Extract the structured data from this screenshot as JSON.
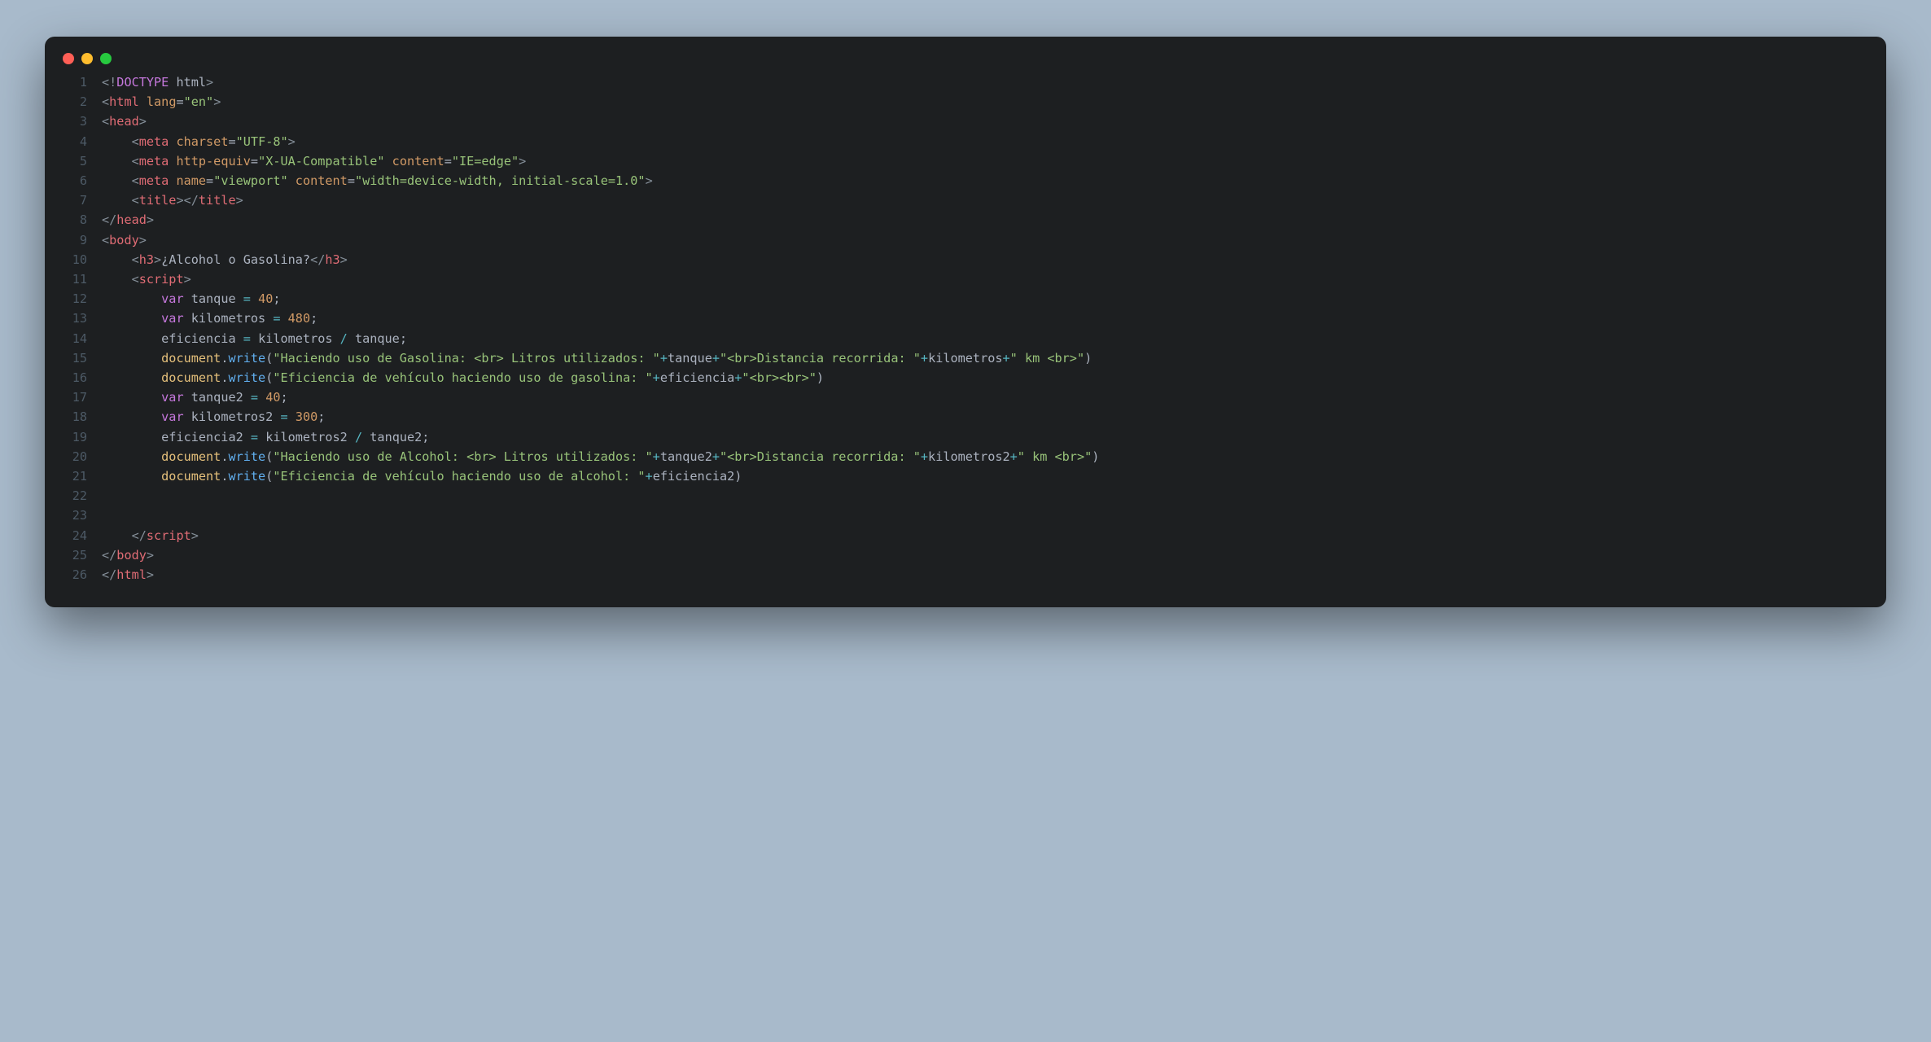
{
  "lines": [
    {
      "n": 1,
      "tokens": [
        [
          "<!",
          "doc"
        ],
        [
          "DOCTYPE",
          "kw"
        ],
        [
          " html",
          "txt"
        ],
        [
          ">",
          "doc"
        ]
      ]
    },
    {
      "n": 2,
      "tokens": [
        [
          "<",
          "p"
        ],
        [
          "html",
          "tag"
        ],
        [
          " ",
          ""
        ],
        [
          "lang",
          "attr"
        ],
        [
          "=",
          "eq"
        ],
        [
          "\"en\"",
          "str"
        ],
        [
          ">",
          "p"
        ]
      ]
    },
    {
      "n": 3,
      "tokens": [
        [
          "<",
          "p"
        ],
        [
          "head",
          "tag"
        ],
        [
          ">",
          "p"
        ]
      ]
    },
    {
      "n": 4,
      "tokens": [
        [
          "    ",
          ""
        ],
        [
          "<",
          "p"
        ],
        [
          "meta",
          "tag"
        ],
        [
          " ",
          ""
        ],
        [
          "charset",
          "attr"
        ],
        [
          "=",
          "eq"
        ],
        [
          "\"UTF-8\"",
          "str"
        ],
        [
          ">",
          "p"
        ]
      ]
    },
    {
      "n": 5,
      "tokens": [
        [
          "    ",
          ""
        ],
        [
          "<",
          "p"
        ],
        [
          "meta",
          "tag"
        ],
        [
          " ",
          ""
        ],
        [
          "http-equiv",
          "attr"
        ],
        [
          "=",
          "eq"
        ],
        [
          "\"X-UA-Compatible\"",
          "str"
        ],
        [
          " ",
          ""
        ],
        [
          "content",
          "attr"
        ],
        [
          "=",
          "eq"
        ],
        [
          "\"IE=edge\"",
          "str"
        ],
        [
          ">",
          "p"
        ]
      ]
    },
    {
      "n": 6,
      "tokens": [
        [
          "    ",
          ""
        ],
        [
          "<",
          "p"
        ],
        [
          "meta",
          "tag"
        ],
        [
          " ",
          ""
        ],
        [
          "name",
          "attr"
        ],
        [
          "=",
          "eq"
        ],
        [
          "\"viewport\"",
          "str"
        ],
        [
          " ",
          ""
        ],
        [
          "content",
          "attr"
        ],
        [
          "=",
          "eq"
        ],
        [
          "\"width=device-width, initial-scale=1.0\"",
          "str"
        ],
        [
          ">",
          "p"
        ]
      ]
    },
    {
      "n": 7,
      "tokens": [
        [
          "    ",
          ""
        ],
        [
          "<",
          "p"
        ],
        [
          "title",
          "tag"
        ],
        [
          ">",
          "p"
        ],
        [
          "</",
          "p"
        ],
        [
          "title",
          "tag"
        ],
        [
          ">",
          "p"
        ]
      ]
    },
    {
      "n": 8,
      "tokens": [
        [
          "</",
          "p"
        ],
        [
          "head",
          "tag"
        ],
        [
          ">",
          "p"
        ]
      ]
    },
    {
      "n": 9,
      "tokens": [
        [
          "<",
          "p"
        ],
        [
          "body",
          "tag"
        ],
        [
          ">",
          "p"
        ]
      ]
    },
    {
      "n": 10,
      "tokens": [
        [
          "    ",
          ""
        ],
        [
          "<",
          "p"
        ],
        [
          "h3",
          "tag"
        ],
        [
          ">",
          "p"
        ],
        [
          "¿Alcohol o Gasolina?",
          "txt"
        ],
        [
          "</",
          "p"
        ],
        [
          "h3",
          "tag"
        ],
        [
          ">",
          "p"
        ]
      ]
    },
    {
      "n": 11,
      "tokens": [
        [
          "    ",
          ""
        ],
        [
          "<",
          "p"
        ],
        [
          "script",
          "tag"
        ],
        [
          ">",
          "p"
        ]
      ]
    },
    {
      "n": 12,
      "tokens": [
        [
          "        ",
          ""
        ],
        [
          "var",
          "jkw"
        ],
        [
          " ",
          ""
        ],
        [
          "tanque",
          "txt"
        ],
        [
          " ",
          ""
        ],
        [
          "=",
          "jop"
        ],
        [
          " ",
          ""
        ],
        [
          "40",
          "jnum"
        ],
        [
          ";",
          "jpun"
        ]
      ]
    },
    {
      "n": 13,
      "tokens": [
        [
          "        ",
          ""
        ],
        [
          "var",
          "jkw"
        ],
        [
          " ",
          ""
        ],
        [
          "kilometros",
          "txt"
        ],
        [
          " ",
          ""
        ],
        [
          "=",
          "jop"
        ],
        [
          " ",
          ""
        ],
        [
          "480",
          "jnum"
        ],
        [
          ";",
          "jpun"
        ]
      ]
    },
    {
      "n": 14,
      "tokens": [
        [
          "        ",
          ""
        ],
        [
          "eficiencia",
          "txt"
        ],
        [
          " ",
          ""
        ],
        [
          "=",
          "jop"
        ],
        [
          " ",
          ""
        ],
        [
          "kilometros",
          "txt"
        ],
        [
          " ",
          ""
        ],
        [
          "/",
          "jop"
        ],
        [
          " ",
          ""
        ],
        [
          "tanque",
          "txt"
        ],
        [
          ";",
          "jpun"
        ]
      ]
    },
    {
      "n": 15,
      "tokens": [
        [
          "        ",
          ""
        ],
        [
          "document",
          "jvar"
        ],
        [
          ".",
          "jpun"
        ],
        [
          "write",
          "jfn"
        ],
        [
          "(",
          "jpun"
        ],
        [
          "\"Haciendo uso de Gasolina: <br> Litros utilizados: \"",
          "str"
        ],
        [
          "+",
          "jop"
        ],
        [
          "tanque",
          "txt"
        ],
        [
          "+",
          "jop"
        ],
        [
          "\"<br>Distancia recorrida: \"",
          "str"
        ],
        [
          "+",
          "jop"
        ],
        [
          "kilometros",
          "txt"
        ],
        [
          "+",
          "jop"
        ],
        [
          "\" km <br>\"",
          "str"
        ],
        [
          ")",
          "jpun"
        ]
      ]
    },
    {
      "n": 16,
      "tokens": [
        [
          "        ",
          ""
        ],
        [
          "document",
          "jvar"
        ],
        [
          ".",
          "jpun"
        ],
        [
          "write",
          "jfn"
        ],
        [
          "(",
          "jpun"
        ],
        [
          "\"Eficiencia de vehículo haciendo uso de gasolina: \"",
          "str"
        ],
        [
          "+",
          "jop"
        ],
        [
          "eficiencia",
          "txt"
        ],
        [
          "+",
          "jop"
        ],
        [
          "\"<br><br>\"",
          "str"
        ],
        [
          ")",
          "jpun"
        ]
      ]
    },
    {
      "n": 17,
      "tokens": [
        [
          "        ",
          ""
        ],
        [
          "var",
          "jkw"
        ],
        [
          " ",
          ""
        ],
        [
          "tanque2",
          "txt"
        ],
        [
          " ",
          ""
        ],
        [
          "=",
          "jop"
        ],
        [
          " ",
          ""
        ],
        [
          "40",
          "jnum"
        ],
        [
          ";",
          "jpun"
        ]
      ]
    },
    {
      "n": 18,
      "tokens": [
        [
          "        ",
          ""
        ],
        [
          "var",
          "jkw"
        ],
        [
          " ",
          ""
        ],
        [
          "kilometros2",
          "txt"
        ],
        [
          " ",
          ""
        ],
        [
          "=",
          "jop"
        ],
        [
          " ",
          ""
        ],
        [
          "300",
          "jnum"
        ],
        [
          ";",
          "jpun"
        ]
      ]
    },
    {
      "n": 19,
      "tokens": [
        [
          "        ",
          ""
        ],
        [
          "eficiencia2",
          "txt"
        ],
        [
          " ",
          ""
        ],
        [
          "=",
          "jop"
        ],
        [
          " ",
          ""
        ],
        [
          "kilometros2",
          "txt"
        ],
        [
          " ",
          ""
        ],
        [
          "/",
          "jop"
        ],
        [
          " ",
          ""
        ],
        [
          "tanque2",
          "txt"
        ],
        [
          ";",
          "jpun"
        ]
      ]
    },
    {
      "n": 20,
      "tokens": [
        [
          "        ",
          ""
        ],
        [
          "document",
          "jvar"
        ],
        [
          ".",
          "jpun"
        ],
        [
          "write",
          "jfn"
        ],
        [
          "(",
          "jpun"
        ],
        [
          "\"Haciendo uso de Alcohol: <br> Litros utilizados: \"",
          "str"
        ],
        [
          "+",
          "jop"
        ],
        [
          "tanque2",
          "txt"
        ],
        [
          "+",
          "jop"
        ],
        [
          "\"<br>Distancia recorrida: \"",
          "str"
        ],
        [
          "+",
          "jop"
        ],
        [
          "kilometros2",
          "txt"
        ],
        [
          "+",
          "jop"
        ],
        [
          "\" km <br>\"",
          "str"
        ],
        [
          ")",
          "jpun"
        ]
      ]
    },
    {
      "n": 21,
      "tokens": [
        [
          "        ",
          ""
        ],
        [
          "document",
          "jvar"
        ],
        [
          ".",
          "jpun"
        ],
        [
          "write",
          "jfn"
        ],
        [
          "(",
          "jpun"
        ],
        [
          "\"Eficiencia de vehículo haciendo uso de alcohol: \"",
          "str"
        ],
        [
          "+",
          "jop"
        ],
        [
          "eficiencia2",
          "txt"
        ],
        [
          ")",
          "jpun"
        ]
      ]
    },
    {
      "n": 22,
      "tokens": []
    },
    {
      "n": 23,
      "tokens": []
    },
    {
      "n": 24,
      "tokens": [
        [
          "    ",
          ""
        ],
        [
          "</",
          "p"
        ],
        [
          "script",
          "tag"
        ],
        [
          ">",
          "p"
        ]
      ]
    },
    {
      "n": 25,
      "tokens": [
        [
          "</",
          "p"
        ],
        [
          "body",
          "tag"
        ],
        [
          ">",
          "p"
        ]
      ]
    },
    {
      "n": 26,
      "tokens": [
        [
          "</",
          "p"
        ],
        [
          "html",
          "tag"
        ],
        [
          ">",
          "p"
        ]
      ]
    }
  ]
}
